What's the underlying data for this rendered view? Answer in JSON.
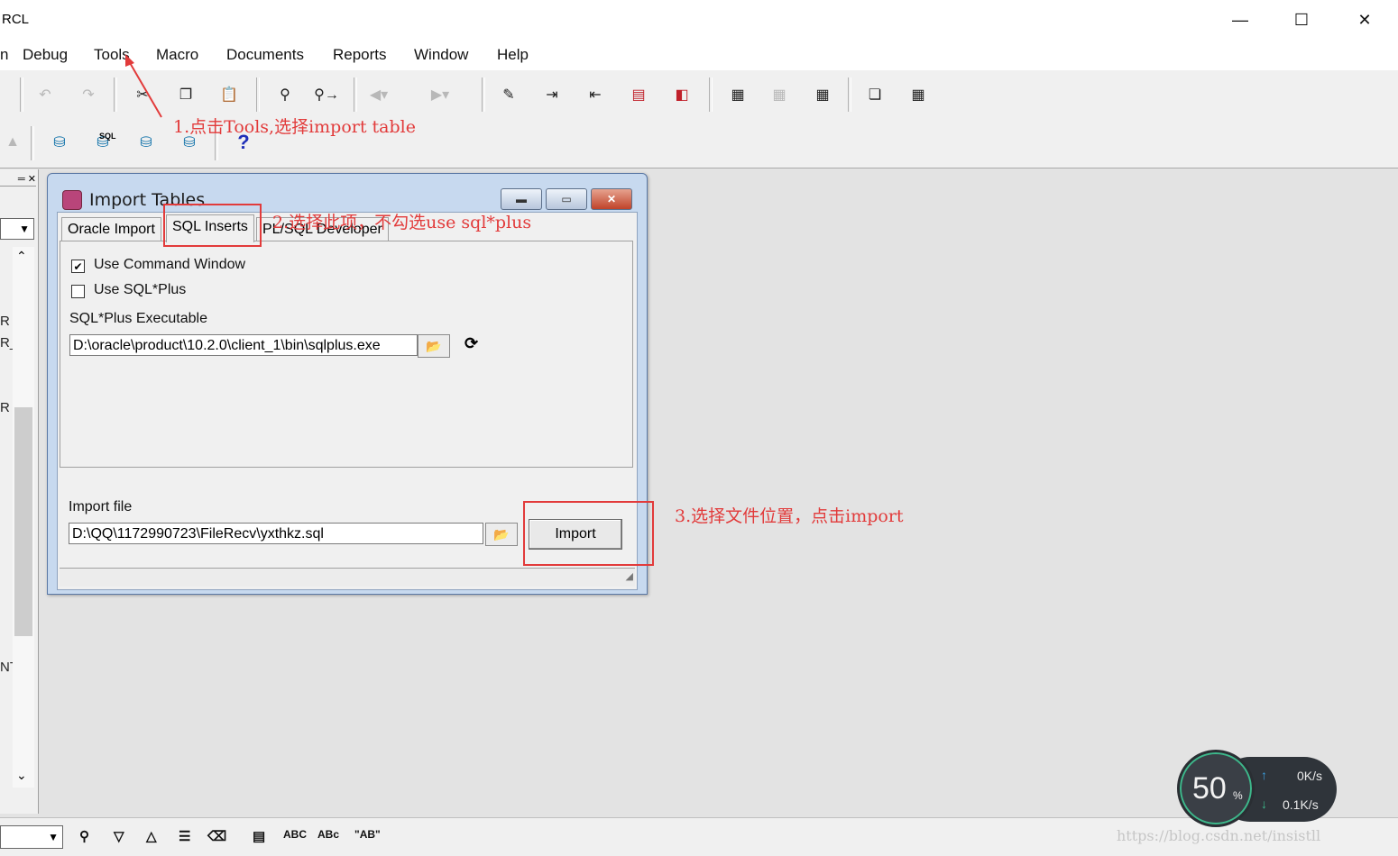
{
  "window": {
    "title": "RCL",
    "controls": {
      "minimize": "—",
      "maximize": "☐",
      "close": "✕"
    }
  },
  "menu": {
    "items": [
      "n",
      "Debug",
      "Tools",
      "Macro",
      "Documents",
      "Reports",
      "Window",
      "Help"
    ]
  },
  "toolbar1": {
    "icons": [
      "undo-icon",
      "redo-icon",
      "cut-icon",
      "copy-icon",
      "paste-icon",
      "find-icon",
      "find-next-icon",
      "back-icon",
      "forward-icon",
      "edit-icon",
      "indent-icon",
      "unindent-icon",
      "page-icon",
      "page-left-icon",
      "film-icon",
      "film-disabled-icon",
      "film-dots-icon",
      "windows-icon",
      "grid-icon"
    ]
  },
  "toolbar2": {
    "icons": [
      "database-icon",
      "sql-database-icon",
      "database-user-icon",
      "database-disconnect-icon",
      "help-icon"
    ],
    "sql_label": "SQL",
    "help_label": "?"
  },
  "left_panel": {
    "fragments": [
      "R",
      "R_(",
      "R",
      "NT"
    ]
  },
  "dialog": {
    "title": "Import Tables",
    "tabs": [
      "Oracle Import",
      "SQL Inserts",
      "PL/SQL Developer"
    ],
    "active_tab": "SQL Inserts",
    "use_command_window": {
      "label": "Use Command Window",
      "checked": true
    },
    "use_sqlplus": {
      "label": "Use SQL*Plus",
      "checked": false
    },
    "sqlplus_executable": {
      "label": "SQL*Plus Executable",
      "value": "D:\\oracle\\product\\10.2.0\\client_1\\bin\\sqlplus.exe"
    },
    "import_file": {
      "label": "Import file",
      "value": "D:\\QQ\\1172990723\\FileRecv\\yxthkz.sql"
    },
    "import_button": "Import"
  },
  "annotations": {
    "step1": "1.点击Tools,选择import table",
    "step2": "2.选择此项，不勾选use sql*plus",
    "step3": "3.选择文件位置，点击import"
  },
  "bottom_toolbar": {
    "labels": [
      "ABC",
      "ABc",
      "\"AB\""
    ]
  },
  "speed_widget": {
    "percent": "50",
    "percent_unit": "%",
    "upload": "0K/s",
    "download": "0.1K/s"
  },
  "watermark": "https://blog.csdn.net/insistll"
}
